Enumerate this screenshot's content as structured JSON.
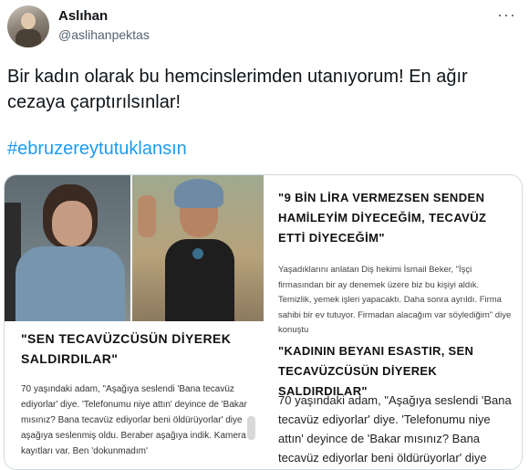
{
  "author": {
    "name": "Aslıhan",
    "handle": "@aslihanpektas"
  },
  "menu": {
    "more_label": "···"
  },
  "tweet": {
    "text": "Bir kadın olarak bu hemcinslerimden utanıyorum! En ağır cezaya çarptırılsınlar!",
    "hashtag": "#ebruzereytutuklansın"
  },
  "media": {
    "left": {
      "headline": "\"SEN TECAVÜZCÜSÜN DİYEREK SALDIRDILAR\"",
      "body": "70 yaşındaki adam, \"Aşağıya seslendi 'Bana tecavüz ediyorlar' diye. 'Telefonumu niye attın' deyince de 'Bakar mısınız? Bana tecavüz ediyorlar beni öldürüyorlar' diye aşağıya seslenmiş oldu. Beraber aşağıya indik. Kamera kayıtları var. Ben 'dokunmadım'"
    },
    "right": {
      "headline1": "\"9 BİN LİRA VERMEZSEN SENDEN HAMİLEYİM DİYECEĞİM, TECAVÜZ ETTİ DİYECEĞİM\"",
      "body1": "Yaşadıklarını anlatan Diş hekimi İsmail Beker, \"İşçi firmasından bir ay denemek üzere biz bu kişiyi aldık. Temizlik, yemek işleri yapacaktı. Daha sonra ayrıldı. Firma sahibi bir ev tutuyor. Firmadan alacağım var söylediğim\" diye konuştu",
      "headline2": "\"KADININ BEYANI ESASTIR, SEN TECAVÜZCÜSÜN DİYEREK SALDIRDILAR\"",
      "body2": "70 yaşındaki adam, \"Aşağıya seslendi 'Bana tecavüz ediyorlar' diye. 'Telefonumu niye attın' deyince de 'Bakar mısınız? Bana tecavüz ediyorlar beni öldürüyorlar' diye"
    }
  }
}
